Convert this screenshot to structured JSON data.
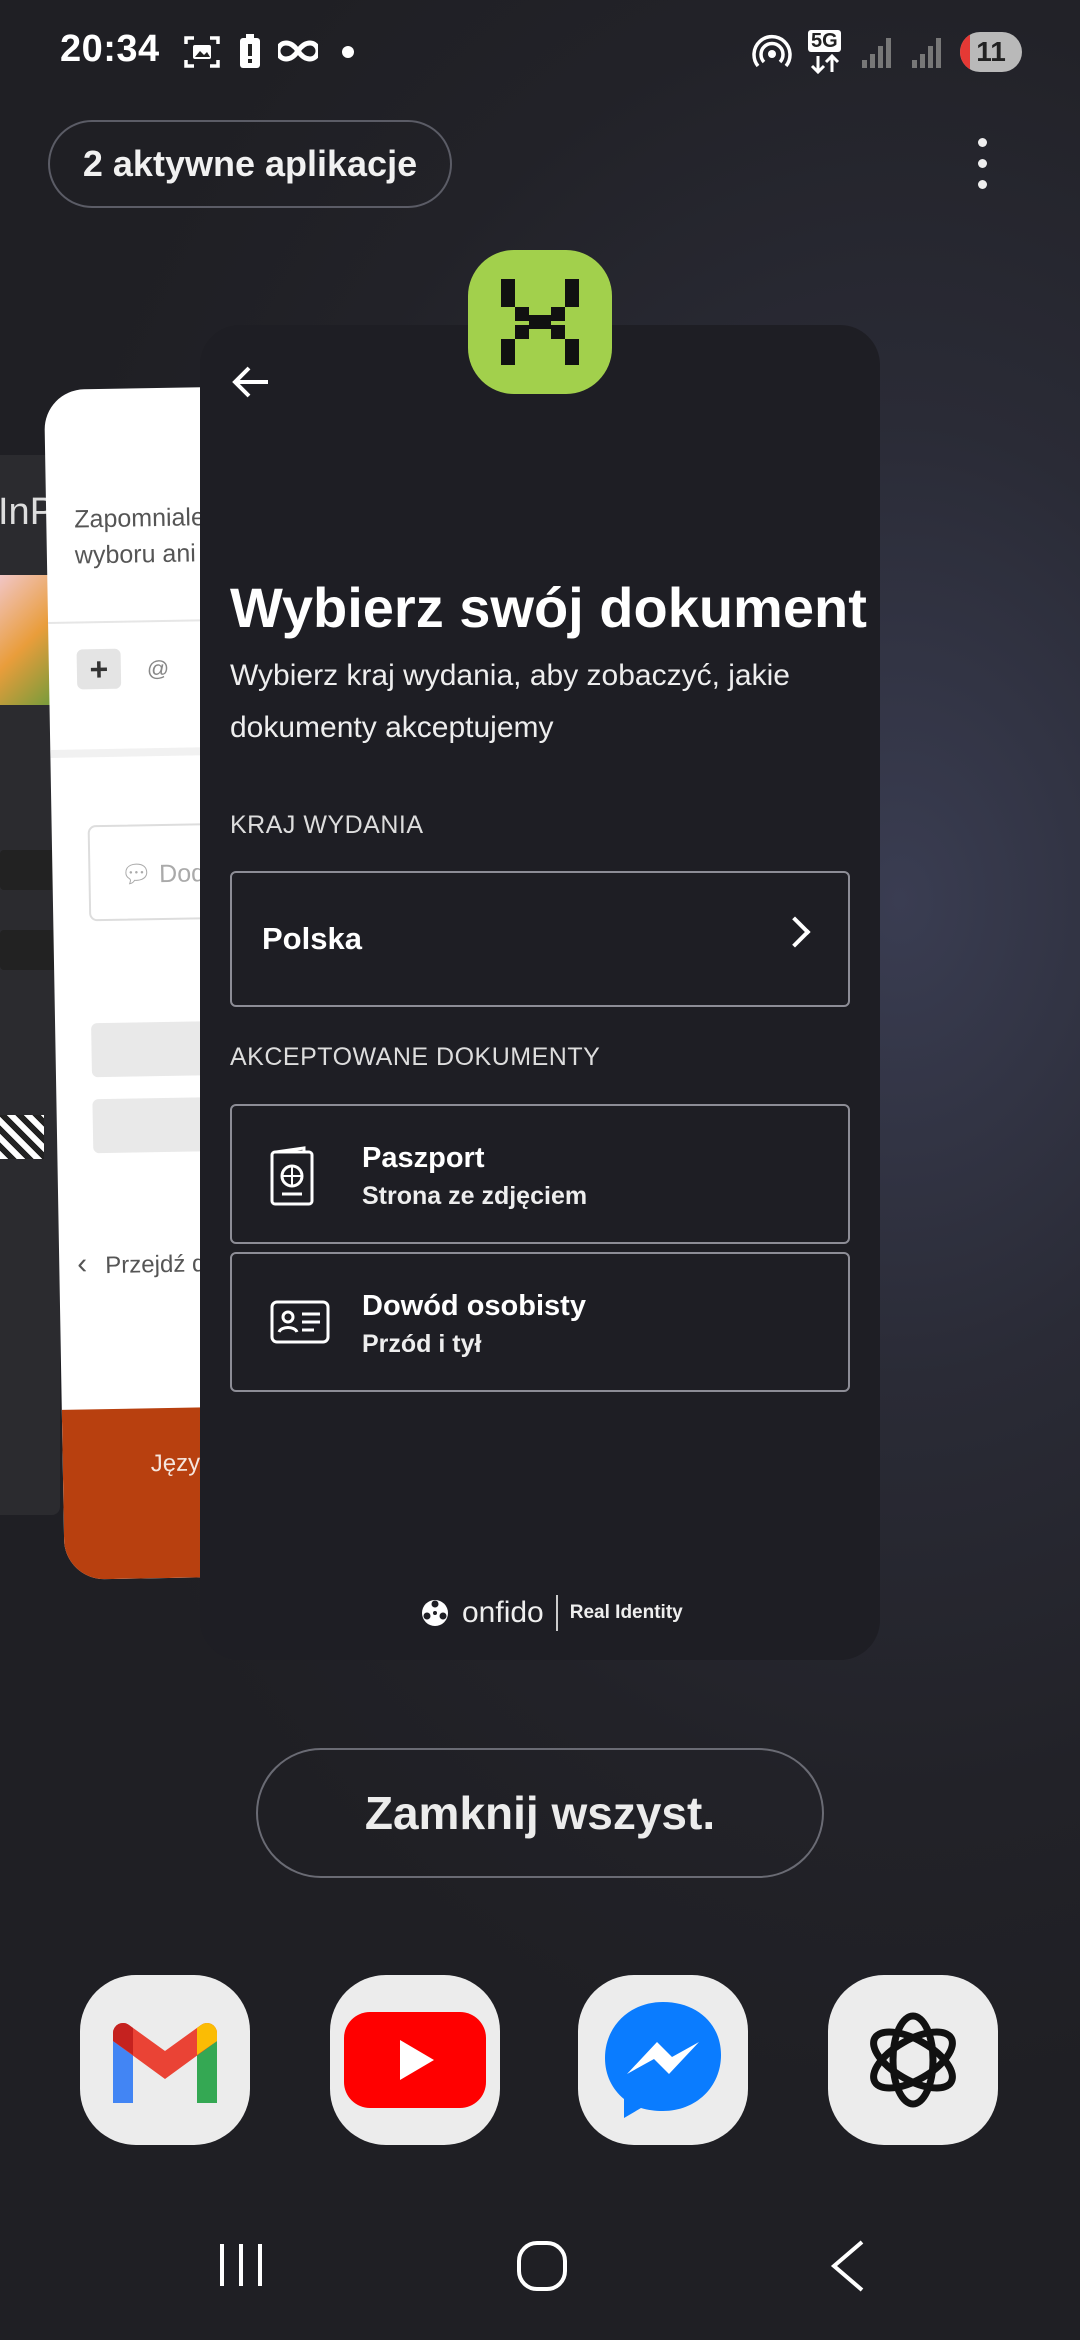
{
  "status_bar": {
    "time": "20:34",
    "battery": "11",
    "network": "5G"
  },
  "recents": {
    "active_apps_label": "2 aktywne aplikacje",
    "close_all_label": "Zamknij wszyst."
  },
  "background_app": {
    "partial_text": "Zapomniales wyboru ani b",
    "input_placeholder": "Doda",
    "back_text": "Przejdź d",
    "footer_text": "Język",
    "far_card_label": "InP"
  },
  "main_app": {
    "title": "Wybierz swój dokument",
    "subtitle": "Wybierz kraj wydania, aby zobaczyć, jakie dokumenty akceptujemy",
    "country_section_label": "KRAJ WYDANIA",
    "country_value": "Polska",
    "documents_section_label": "AKCEPTOWANE DOKUMENTY",
    "documents": [
      {
        "title": "Paszport",
        "subtitle": "Strona ze zdjęciem",
        "icon": "passport-icon"
      },
      {
        "title": "Dowód osobisty",
        "subtitle": "Przód i tył",
        "icon": "id-card-icon"
      }
    ],
    "brand_name": "onfido",
    "brand_tagline": "Real Identity",
    "accent_color": "#a2d04c"
  },
  "dock": [
    {
      "name": "Gmail",
      "icon": "gmail-icon"
    },
    {
      "name": "YouTube",
      "icon": "youtube-icon"
    },
    {
      "name": "Messenger",
      "icon": "messenger-icon"
    },
    {
      "name": "ChatGPT",
      "icon": "chatgpt-icon"
    }
  ],
  "nav_bar": [
    "recents-icon",
    "home-icon",
    "back-icon"
  ]
}
